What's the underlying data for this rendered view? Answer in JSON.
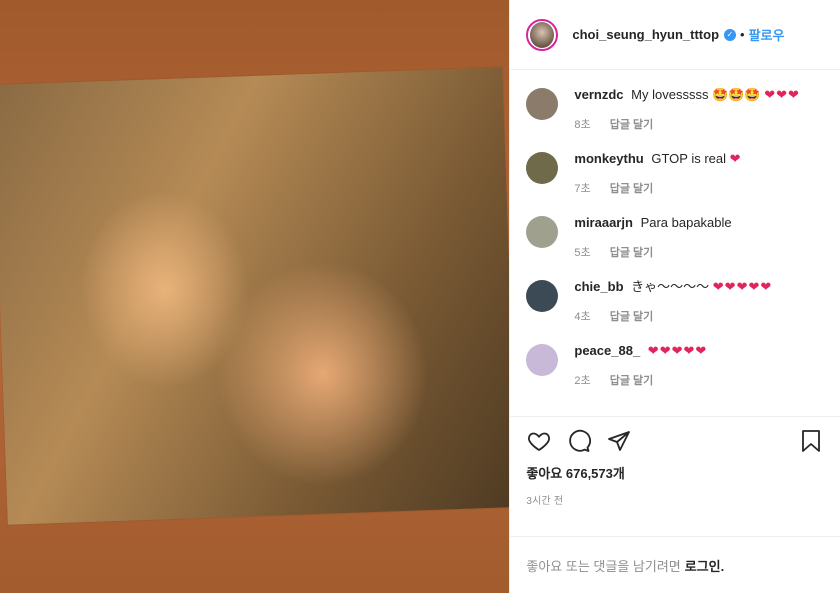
{
  "header": {
    "username": "choi_seung_hyun_tttop",
    "verified_icon": "verified-badge-icon",
    "separator": "•",
    "follow_label": "팔로우"
  },
  "comments": [
    {
      "user": "vernzdc",
      "text": "My lovesssss 🤩🤩🤩",
      "hearts": "❤❤❤",
      "time": "8초",
      "reply": "답글 달기",
      "avatar_color": "#8b7b6b"
    },
    {
      "user": "monkeythu",
      "text": "GTOP is real",
      "hearts": "❤",
      "time": "7초",
      "reply": "답글 달기",
      "avatar_color": "#6f6a4a"
    },
    {
      "user": "miraaarjn",
      "text": "Para bapakable",
      "hearts": "",
      "time": "5초",
      "reply": "답글 달기",
      "avatar_color": "#9fa08e"
    },
    {
      "user": "chie_bb",
      "text": "きゃ〜〜〜〜",
      "hearts": "❤❤❤❤❤",
      "time": "4초",
      "reply": "답글 달기",
      "avatar_color": "#3c4a55"
    },
    {
      "user": "peace_88_",
      "text": "",
      "hearts": "❤❤❤❤❤",
      "time": "2초",
      "reply": "답글 달기",
      "avatar_color": "#c9b9d8"
    }
  ],
  "actions": {
    "like_icon": "heart-icon",
    "comment_icon": "comment-icon",
    "share_icon": "share-icon",
    "save_icon": "bookmark-icon",
    "likes_text": "좋아요 676,573개",
    "time_ago": "3시간 전"
  },
  "login": {
    "prompt": "좋아요 또는 댓글을 남기려면",
    "link": "로그인."
  },
  "colors": {
    "accent": "#3897f0",
    "heart": "#e0245e",
    "muted": "#8e8e8e",
    "photo_bg": "#a85f30"
  }
}
